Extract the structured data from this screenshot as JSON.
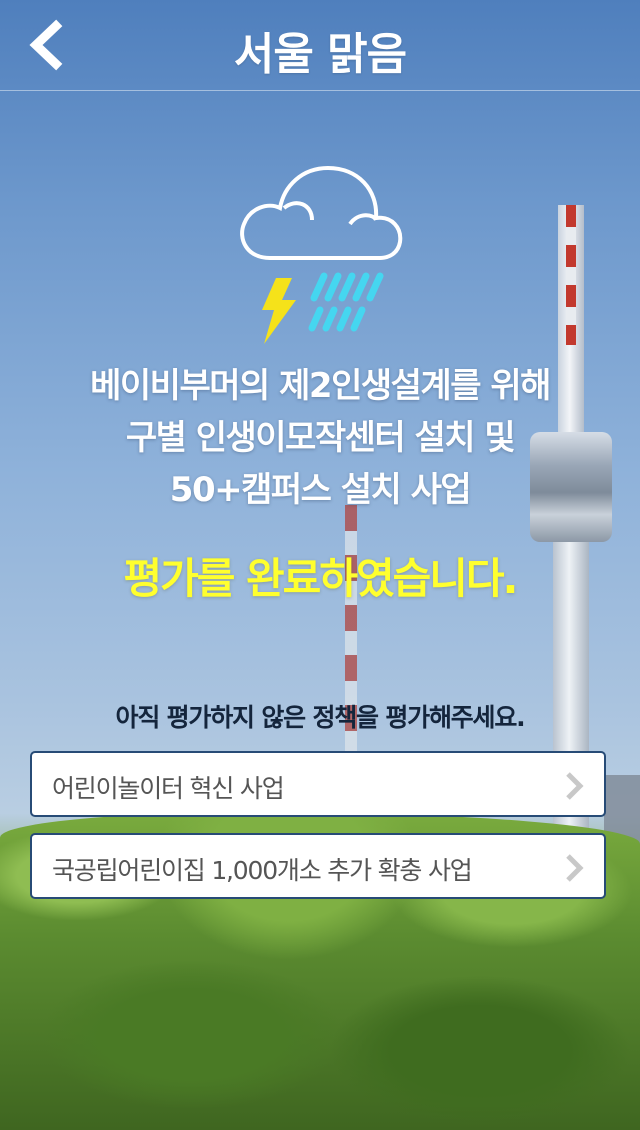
{
  "header": {
    "title": "서울 맑음",
    "back_icon": "chevron-left-icon"
  },
  "weather": {
    "icon": "thunderstorm-rain-icon",
    "colors": {
      "cloud": "#ffffff",
      "lightning": "#f5e21a",
      "rain": "#45d6f0"
    }
  },
  "policy": {
    "title_lines": [
      "베이비부머의 제2인생설계를 위해",
      "구별 인생이모작센터 설치 및",
      "50+캠퍼스 설치 사업"
    ]
  },
  "status": {
    "message": "평가를 완료하였습니다.",
    "color": "#ffff2e"
  },
  "unrated": {
    "prompt": "아직 평가하지 않은 정책을 평가해주세요.",
    "items": [
      {
        "label": "어린이놀이터 혁신 사업",
        "icon": "chevron-right-icon"
      },
      {
        "label": "국공립어린이집 1,000개소 추가 확충 사업",
        "icon": "chevron-right-icon"
      }
    ]
  }
}
